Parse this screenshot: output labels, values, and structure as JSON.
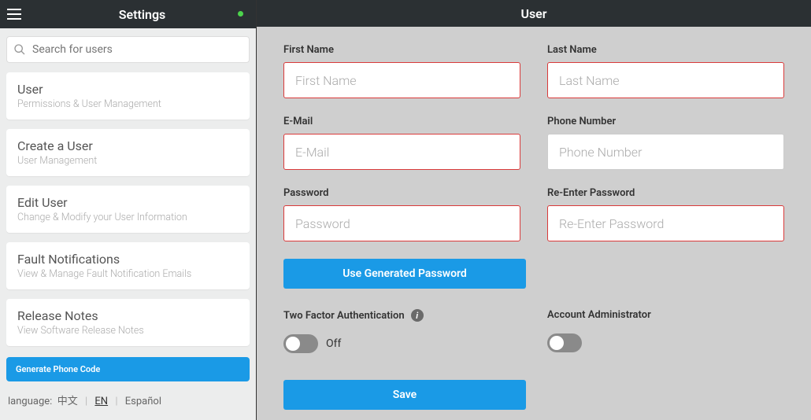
{
  "sidebar": {
    "title": "Settings",
    "search_placeholder": "Search for users",
    "items": [
      {
        "title": "User",
        "subtitle": "Permissions & User Management"
      },
      {
        "title": "Create a User",
        "subtitle": "User Management"
      },
      {
        "title": "Edit User",
        "subtitle": "Change & Modify your User Information"
      },
      {
        "title": "Fault Notifications",
        "subtitle": "View & Manage Fault Notification Emails"
      },
      {
        "title": "Release Notes",
        "subtitle": "View Software Release Notes"
      }
    ],
    "phone_code_btn": "Generate Phone Code",
    "lang_label": "language:",
    "langs": {
      "zh": "中文",
      "en": "EN",
      "es": "Español"
    }
  },
  "main": {
    "title": "User",
    "fields": {
      "first_name": {
        "label": "First Name",
        "placeholder": "First Name"
      },
      "last_name": {
        "label": "Last Name",
        "placeholder": "Last Name"
      },
      "email": {
        "label": "E-Mail",
        "placeholder": "E-Mail"
      },
      "phone": {
        "label": "Phone Number",
        "placeholder": "Phone Number"
      },
      "password": {
        "label": "Password",
        "placeholder": "Password"
      },
      "repassword": {
        "label": "Re-Enter Password",
        "placeholder": "Re-Enter Password"
      }
    },
    "gen_pwd_btn": "Use Generated Password",
    "tfa_label": "Two Factor Authentication",
    "tfa_state": "Off",
    "admin_label": "Account Administrator",
    "save_btn": "Save"
  }
}
